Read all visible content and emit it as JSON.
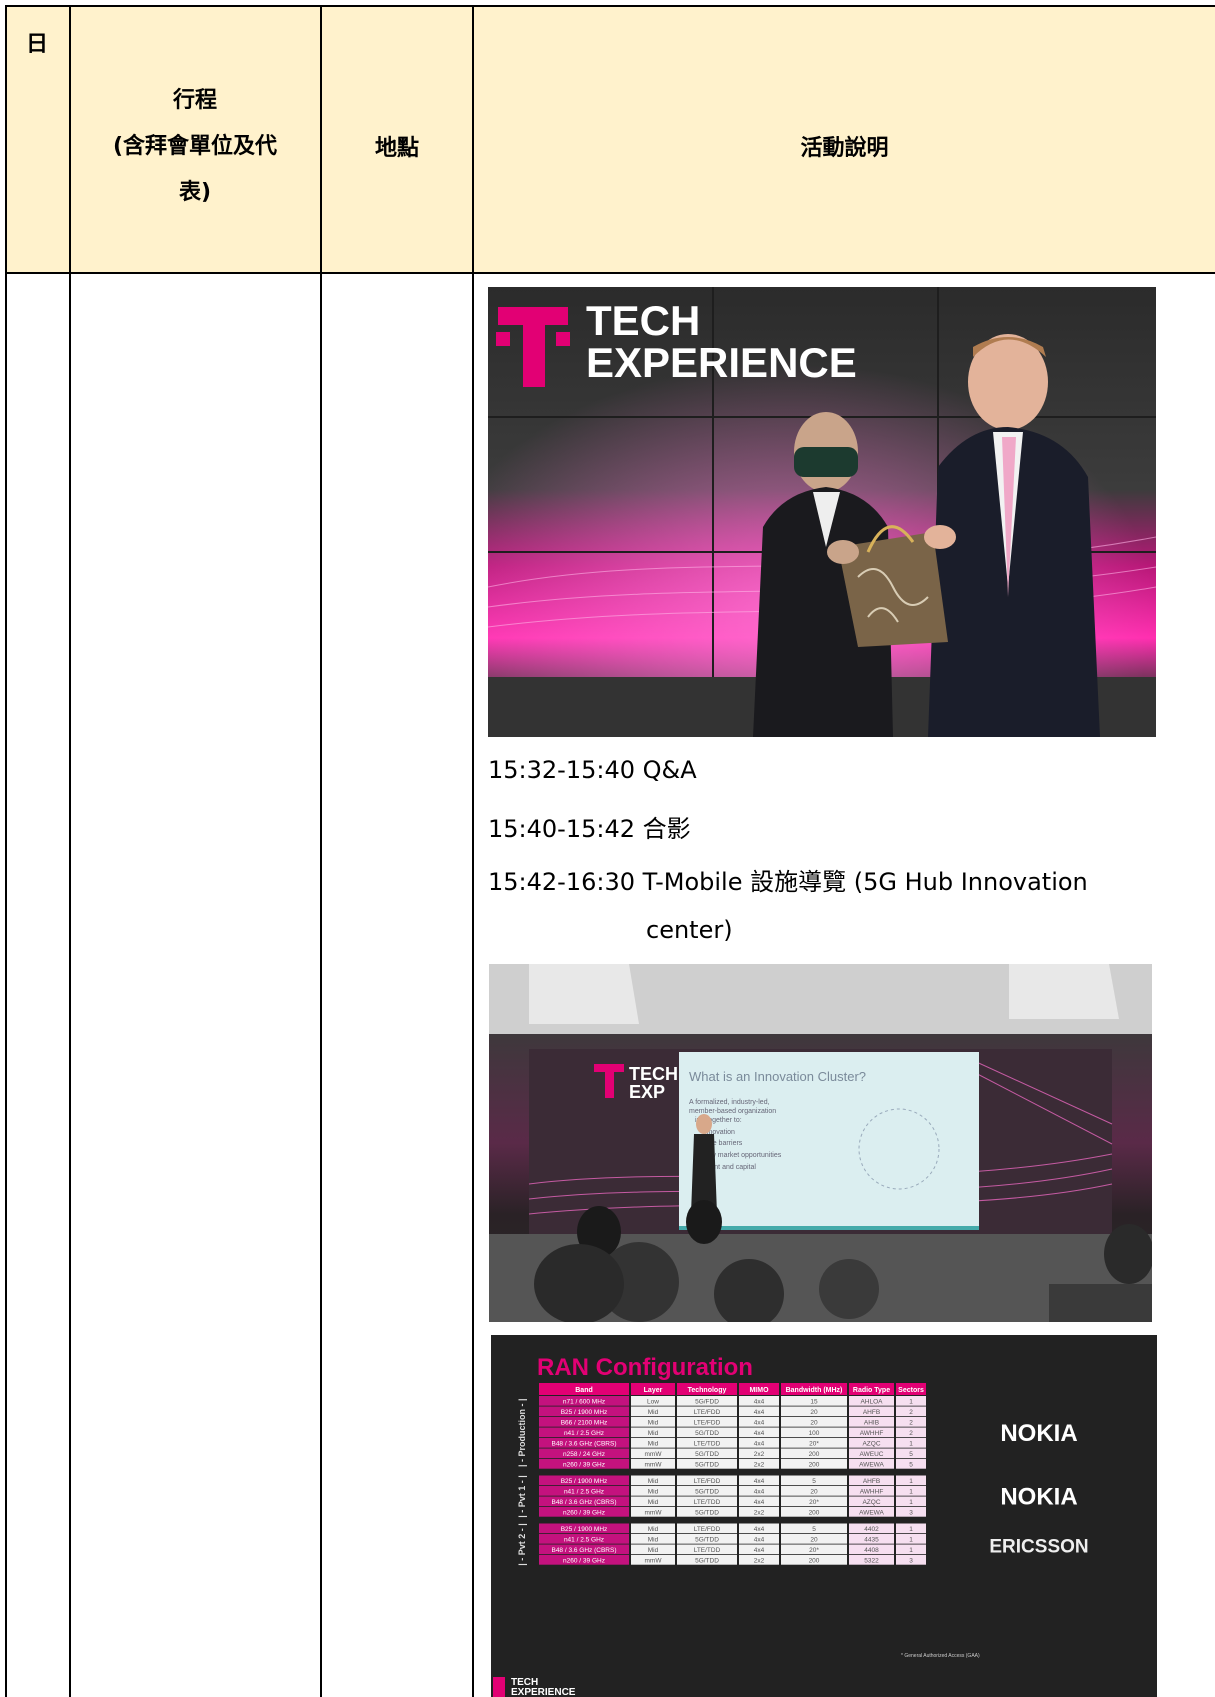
{
  "header": {
    "col_day": "日",
    "col_itinerary_line1": "行程",
    "col_itinerary_line2": "(含拜會單位及代",
    "col_itinerary_line3": "表)",
    "col_location": "地點",
    "col_activity": "活動說明"
  },
  "photo1": {
    "logo_text_line1": "TECH",
    "logo_text_line2": "EXPERIENCE"
  },
  "activities": [
    "15:32-15:40 Q&A",
    "15:40-15:42 合影",
    "15:42-16:30 T-Mobile 設施導覽 (5G Hub Innovation",
    "center)"
  ],
  "photo2": {
    "logo_text_line1": "TECH",
    "logo_text_line2": "EXP",
    "slide_title": "What is an Innovation Cluster?",
    "slide_lines": [
      "A formalized, industry-led,",
      "member-based organization",
      "ing together to:",
      "innovation",
      "ome barriers",
      "new market opportunities",
      "talent and capital"
    ]
  },
  "photo3": {
    "title": "RAN Configuration",
    "columns": [
      "Band",
      "Layer",
      "Technology",
      "MIMO",
      "Bandwidth (MHz)",
      "Radio Type",
      "Sectors"
    ],
    "groups": [
      {
        "label": "| - Production - |",
        "vendor": "NOKIA",
        "rows": [
          [
            "n71 / 600 MHz",
            "Low",
            "5G/FDD",
            "4x4",
            "15",
            "AHLOA",
            "1"
          ],
          [
            "B25 / 1900 MHz",
            "Mid",
            "LTE/FDD",
            "4x4",
            "20",
            "AHFB",
            "2"
          ],
          [
            "B66 / 2100 MHz",
            "Mid",
            "LTE/FDD",
            "4x4",
            "20",
            "AHIB",
            "2"
          ],
          [
            "n41 / 2.5 GHz",
            "Mid",
            "5G/TDD",
            "4x4",
            "100",
            "AWHHF",
            "2"
          ],
          [
            "B48 / 3.6 GHz (CBRS)",
            "Mid",
            "LTE/TDD",
            "4x4",
            "20*",
            "AZQC",
            "1"
          ],
          [
            "n258 / 24 GHz",
            "mmW",
            "5G/TDD",
            "2x2",
            "200",
            "AWEUC",
            "5"
          ],
          [
            "n260 / 39 GHz",
            "mmW",
            "5G/TDD",
            "2x2",
            "200",
            "AWEWA",
            "5"
          ]
        ]
      },
      {
        "label": "| - Pvt 1 - |",
        "vendor": "NOKIA",
        "rows": [
          [
            "B25 / 1900 MHz",
            "Mid",
            "LTE/FDD",
            "4x4",
            "5",
            "AHFB",
            "1"
          ],
          [
            "n41 / 2.5 GHz",
            "Mid",
            "5G/TDD",
            "4x4",
            "20",
            "AWHHF",
            "1"
          ],
          [
            "B48 / 3.6 GHz (CBRS)",
            "Mid",
            "LTE/TDD",
            "4x4",
            "20*",
            "AZQC",
            "1"
          ],
          [
            "n260 / 39 GHz",
            "mmW",
            "5G/TDD",
            "2x2",
            "200",
            "AWEWA",
            "3"
          ]
        ]
      },
      {
        "label": "| - Pvt 2 - |",
        "vendor": "ERICSSON",
        "rows": [
          [
            "B25 / 1900 MHz",
            "Mid",
            "LTE/FDD",
            "4x4",
            "5",
            "4402",
            "1"
          ],
          [
            "n41 / 2.5 GHz",
            "Mid",
            "5G/TDD",
            "4x4",
            "20",
            "4435",
            "1"
          ],
          [
            "B48 / 3.6 GHz (CBRS)",
            "Mid",
            "LTE/TDD",
            "4x4",
            "20*",
            "4408",
            "1"
          ],
          [
            "n260 / 39 GHz",
            "mmW",
            "5G/TDD",
            "2x2",
            "200",
            "5322",
            "3"
          ]
        ]
      }
    ],
    "footnote": "* General Authorized Access (GAA)",
    "logo_line1": "TECH",
    "logo_line2": "EXPERIENCE"
  },
  "colors": {
    "header_bg": "#fff2cc",
    "magenta": "#e20074"
  }
}
